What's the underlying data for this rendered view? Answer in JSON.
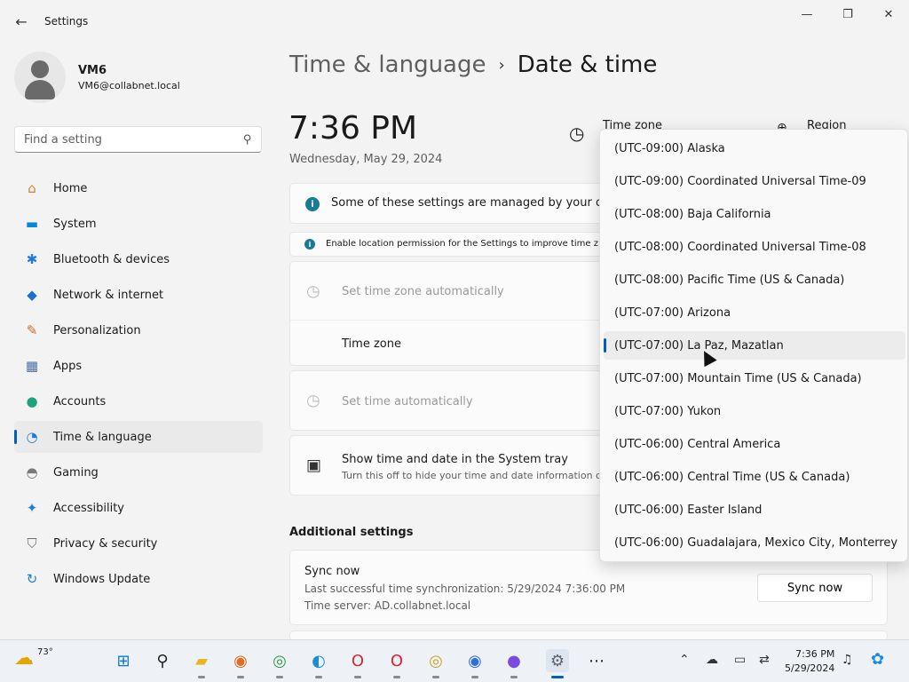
{
  "window": {
    "title": "Settings",
    "back_glyph": "←",
    "min_glyph": "—",
    "max_glyph": "❐",
    "close_glyph": "✕"
  },
  "profile": {
    "name": "VM6",
    "email": "VM6@collabnet.local"
  },
  "search": {
    "placeholder": "Find a setting",
    "icon": "⚲"
  },
  "nav": [
    {
      "label": "Home",
      "icon": "⌂",
      "icon_color": "#d97c2b"
    },
    {
      "label": "System",
      "icon": "▬",
      "icon_color": "#0a86d8"
    },
    {
      "label": "Bluetooth & devices",
      "icon": "✱",
      "icon_color": "#1d7ae0"
    },
    {
      "label": "Network & internet",
      "icon": "◆",
      "icon_color": "#1d6fd1"
    },
    {
      "label": "Personalization",
      "icon": "✎",
      "icon_color": "#c9692d"
    },
    {
      "label": "Apps",
      "icon": "▦",
      "icon_color": "#4a6fa5"
    },
    {
      "label": "Accounts",
      "icon": "●",
      "icon_color": "#1fa37a"
    },
    {
      "label": "Time & language",
      "icon": "◔",
      "icon_color": "#1c7fd6"
    },
    {
      "label": "Gaming",
      "icon": "◓",
      "icon_color": "#7a7a7a"
    },
    {
      "label": "Accessibility",
      "icon": "✦",
      "icon_color": "#1f7fd8"
    },
    {
      "label": "Privacy & security",
      "icon": "⛉",
      "icon_color": "#6f6f6f"
    },
    {
      "label": "Windows Update",
      "icon": "↻",
      "icon_color": "#1c7fd6"
    }
  ],
  "breadcrumb": {
    "parent": "Time & language",
    "separator": "›",
    "current": "Date & time"
  },
  "clock": {
    "time": "7:36 PM",
    "date": "Wednesday, May 29, 2024"
  },
  "header": {
    "timezone_label": "Time zone",
    "region_label": "Region",
    "tz_icon": "◷",
    "region_icon": "⊕"
  },
  "notices": {
    "managed": "Some of these settings are managed by your org",
    "location": "Enable location permission for the Settings to improve time z"
  },
  "rows": {
    "auto_tz": "Set time zone automatically",
    "timezone": "Time zone",
    "auto_time": "Set time automatically",
    "tray_title": "Show time and date in the System tray",
    "tray_desc": "Turn this off to hide your time and date information c"
  },
  "additional": {
    "title": "Additional settings",
    "sync_title": "Sync now",
    "last_sync": "Last successful time synchronization: 5/29/2024 7:36:00 PM",
    "server": "Time server: AD.collabnet.local",
    "sync_button": "Sync now"
  },
  "dropdown": {
    "selected_index": 6,
    "options": [
      "(UTC-09:00) Alaska",
      "(UTC-09:00) Coordinated Universal Time-09",
      "(UTC-08:00) Baja California",
      "(UTC-08:00) Coordinated Universal Time-08",
      "(UTC-08:00) Pacific Time (US & Canada)",
      "(UTC-07:00) Arizona",
      "(UTC-07:00) La Paz, Mazatlan",
      "(UTC-07:00) Mountain Time (US & Canada)",
      "(UTC-07:00) Yukon",
      "(UTC-06:00) Central America",
      "(UTC-06:00) Central Time (US & Canada)",
      "(UTC-06:00) Easter Island",
      "(UTC-06:00) Guadalajara, Mexico City, Monterrey"
    ]
  },
  "taskbar": {
    "weather_temp": "73°",
    "weather_icon": "☁",
    "apps": [
      {
        "name": "start-icon",
        "glyph": "⊞",
        "color": "#0a78d7"
      },
      {
        "name": "search-icon",
        "glyph": "⚲",
        "color": "#222222"
      },
      {
        "name": "file-explorer-icon",
        "glyph": "▰",
        "color": "#e8b622"
      },
      {
        "name": "firefox-icon",
        "glyph": "◉",
        "color": "#e66a1f"
      },
      {
        "name": "chrome-icon",
        "glyph": "◎",
        "color": "#2e9a46"
      },
      {
        "name": "edge-icon",
        "glyph": "◐",
        "color": "#1a8fce"
      },
      {
        "name": "opera-outline-icon",
        "glyph": "O",
        "color": "#d22a3a"
      },
      {
        "name": "opera-icon",
        "glyph": "O",
        "color": "#e01e2e"
      },
      {
        "name": "chrome-canary-icon",
        "glyph": "◎",
        "color": "#c9a227"
      },
      {
        "name": "chromium-icon",
        "glyph": "◉",
        "color": "#2f6fdb"
      },
      {
        "name": "browser-icon",
        "glyph": "●",
        "color": "#7a4be0"
      },
      {
        "name": "settings-icon",
        "glyph": "⚙",
        "color": "#5b6470"
      },
      {
        "name": "more-icon",
        "glyph": "⋯",
        "color": "#222222"
      }
    ],
    "tray": {
      "time": "7:36 PM",
      "date": "5/29/2024"
    }
  }
}
